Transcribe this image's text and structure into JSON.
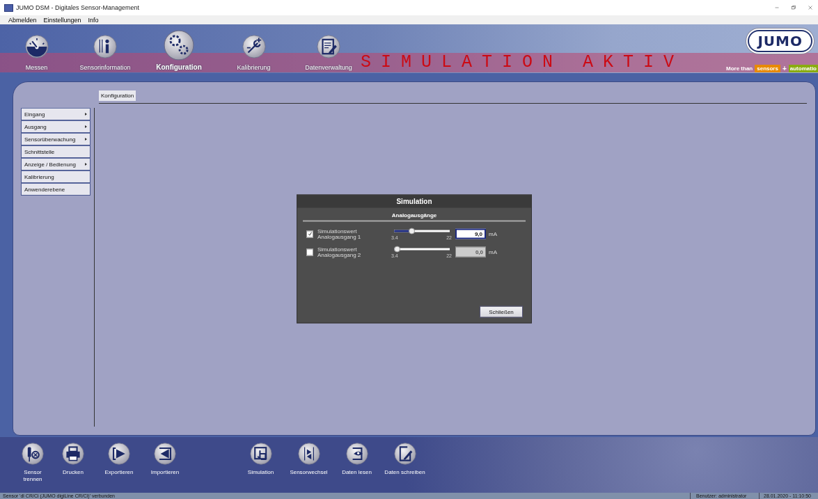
{
  "window": {
    "title": "JUMO DSM - Digitales Sensor-Management"
  },
  "menu": [
    "Abmelden",
    "Einstellungen",
    "Info"
  ],
  "nav": [
    {
      "label": "Messen",
      "selected": false
    },
    {
      "label": "Sensorinformation",
      "selected": false
    },
    {
      "label": "Konfiguration",
      "selected": true
    },
    {
      "label": "Kalibrierung",
      "selected": false
    },
    {
      "label": "Datenverwaltung",
      "selected": false
    }
  ],
  "banner": "SIMULATION AKTIV",
  "brand": {
    "logo": "JUMO",
    "tagline": "More than",
    "tag_1": "sensors",
    "plus": "+",
    "tag_2": "automatio"
  },
  "breadcrumb": "Konfiguration",
  "sidebar": {
    "items": [
      {
        "label": "Eingang",
        "submenu": true
      },
      {
        "label": "Ausgang",
        "submenu": true
      },
      {
        "label": "Sensorüberwachung",
        "submenu": true
      },
      {
        "label": "Schnittstelle",
        "submenu": false
      },
      {
        "label": "Anzeige / Bedienung",
        "submenu": true
      },
      {
        "label": "Kalibrierung",
        "submenu": false
      },
      {
        "label": "Anwenderebene",
        "submenu": false
      }
    ]
  },
  "dialog": {
    "title": "Simulation",
    "section": "Analogausgänge",
    "rows": [
      {
        "label": "Simulationswert Analogausgang 1",
        "checked": true,
        "level": 0.3,
        "min": "3.4",
        "max": "22",
        "value": "9,0",
        "unit": "mA",
        "disabled": false
      },
      {
        "label": "Simulationswert Analogausgang 2",
        "checked": false,
        "level": 0,
        "min": "3.4",
        "max": "22",
        "value": "0,0",
        "unit": "mA",
        "disabled": true
      }
    ],
    "button": "Schließen"
  },
  "toolbar": {
    "left": [
      "Sensor trennen",
      "Drucken",
      "Exportieren",
      "Importieren"
    ],
    "right": [
      "Simulation",
      "Sensorwechsel",
      "Daten lesen",
      "Daten schreiben"
    ]
  },
  "status_bar": {
    "connection": "Sensor 'dl CR/Ci (JUMO digiLine CR/Ci)' verbunden",
    "user": "Benutzer: administrator",
    "datetime": "28.01.2020 - 11:10:50"
  }
}
